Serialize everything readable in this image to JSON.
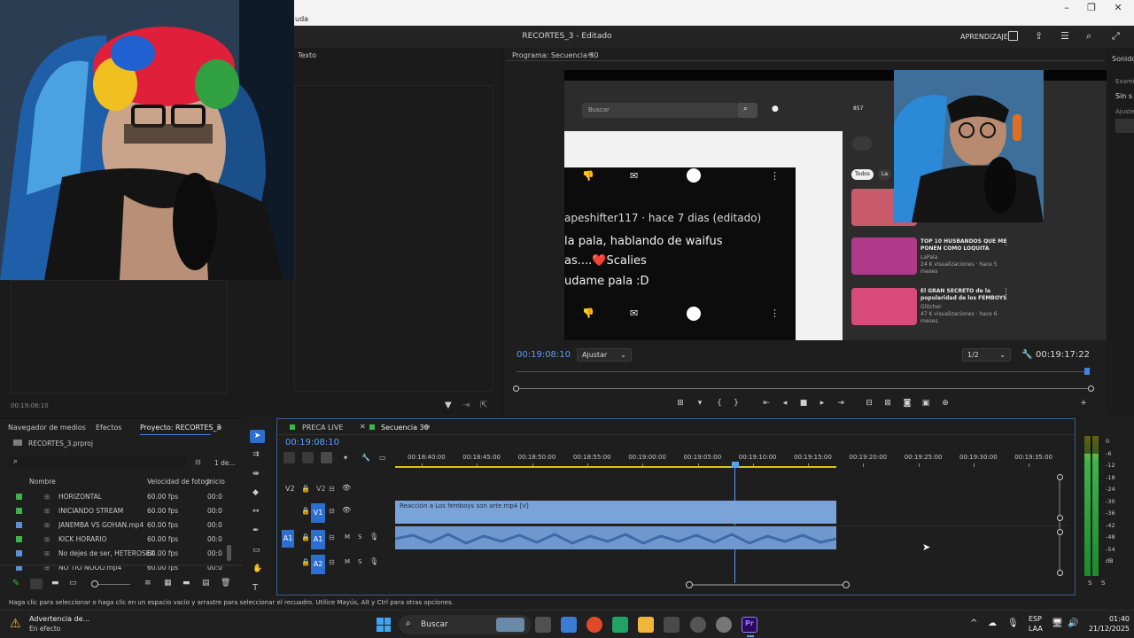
{
  "window": {
    "menu_fragment": "uda",
    "title": "RECORTES_3 - Editado",
    "workspace_label": "APRENDIZAJE"
  },
  "source_panel": {
    "tab_label": "Texto",
    "timecode": "00:19:08:10"
  },
  "program_monitor": {
    "tab_label": "Programa: Secuencia 30",
    "current_timecode": "00:19:08:10",
    "fit_dropdown": "Ajustar",
    "resolution_dropdown": "1/2",
    "duration_timecode": "00:19:17:22"
  },
  "video_content": {
    "search_placeholder": "Buscar",
    "counter_text": "857",
    "comment_author": "apeshifter117 · hace 7 dias (editado)",
    "comment_lines": [
      "la pala, hablando de waifus",
      "as....❤️Scalies",
      "udame pala :D"
    ],
    "chip_all": "Todos",
    "chip_partial": "La",
    "side_videos": [
      {
        "title": "TOP 10 HUSBANDOS QUE ME PONEN COMO LOQUITA",
        "channel": "LaPala",
        "meta": "24 K visualizaciones · hace 5 meses"
      },
      {
        "title": "El GRAN SECRETO de la popularidad de los FEMBOYS",
        "channel": "Glitcher",
        "meta": "47 K visualizaciones · hace 6 meses"
      }
    ]
  },
  "right_panel": {
    "tab_label": "Sonido",
    "line1": "Exami",
    "line2": "Sin s",
    "line3": "Ajuste"
  },
  "project_panel": {
    "tabs": [
      "Navegador de medios",
      "Efectos",
      "Proyecto: RECORTES_3"
    ],
    "project_file": "RECORTES_3.prproj",
    "item_count": "1 de...",
    "columns": [
      "Nombre",
      "Velocidad de fotogr",
      "Inicio"
    ],
    "items": [
      {
        "name": "HORIZONTAL",
        "fps": "60.00 fps",
        "start": "00:0",
        "color": "#3cb44b"
      },
      {
        "name": "INICIANDO STREAM",
        "fps": "60.00 fps",
        "start": "00:0",
        "color": "#3cb44b"
      },
      {
        "name": "JANEMBA VS GOHAN.mp4",
        "fps": "60.00 fps",
        "start": "00:0",
        "color": "#5b8fd6"
      },
      {
        "name": "KICK HORARIO",
        "fps": "60.00 fps",
        "start": "00:0",
        "color": "#3cb44b"
      },
      {
        "name": "No dejes de ser, HETEROSEX",
        "fps": "60.00 fps",
        "start": "00:0",
        "color": "#5b8fd6"
      },
      {
        "name": "NO TIO NOOO.mp4",
        "fps": "60.00 fps",
        "start": "00:0",
        "color": "#5b8fd6"
      }
    ]
  },
  "timeline": {
    "tabs": [
      "PRECA LIVE",
      "Secuencia 30"
    ],
    "timecode": "00:19:08:10",
    "ruler_labels": [
      "00:18:40:00",
      "00:18:45:00",
      "00:18:50:00",
      "00:18:55:00",
      "00:19:00:00",
      "00:19:05:00",
      "00:19:10:00",
      "00:19:15:00",
      "00:19:20:00",
      "00:19:25:00",
      "00:19:30:00",
      "00:19:35:00"
    ],
    "tracks": [
      "V2",
      "V1",
      "A1",
      "A2"
    ],
    "video_clip_label": "Reacción a Los femboys son arte.mp4 [V]",
    "audio_labels": [
      "M",
      "S"
    ]
  },
  "meter": {
    "labels": [
      "0",
      "-6",
      "-12",
      "-18",
      "-24",
      "-30",
      "-36",
      "-42",
      "-48",
      "-54",
      "dB"
    ],
    "channels": [
      "S",
      "S"
    ]
  },
  "status_bar": {
    "text": "Haga clic para seleccionar o haga clic en un espacio vacío y arrastre para seleccionar el recuadro. Utilice Mayús, Alt y Ctrl para otras opciones."
  },
  "taskbar": {
    "warning_title": "Advertencia de...",
    "warning_sub": "En efecto",
    "search_text": "Buscar",
    "lang_top": "ESP",
    "lang_bottom": "LAA",
    "time": "01:40",
    "date": "21/12/2025"
  }
}
